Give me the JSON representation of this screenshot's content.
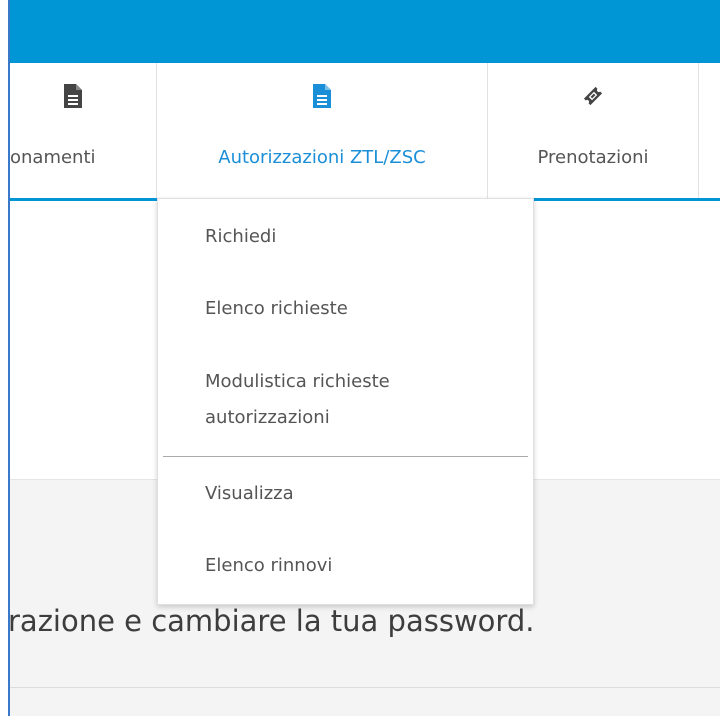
{
  "navbar": {
    "items": [
      {
        "label": "Abbonamenti",
        "display": "onamenti",
        "icon": "document-icon",
        "active": false
      },
      {
        "label": "Autorizzazioni ZTL/ZSC",
        "icon": "document-icon",
        "active": true
      },
      {
        "label": "Prenotazioni",
        "icon": "ticket-icon",
        "active": false
      }
    ]
  },
  "dropdown": {
    "items": [
      {
        "label": "Richiedi"
      },
      {
        "label": "Elenco richieste"
      },
      {
        "label": "Modulistica richieste autorizzazioni"
      },
      {
        "label": "Visualizza"
      },
      {
        "label": "Elenco rinnovi"
      }
    ]
  },
  "main": {
    "text": "razione e cambiare la tua password."
  },
  "colors": {
    "topbar": "#0096d6",
    "active_tab": "#1a8fd8",
    "text": "#555555"
  }
}
